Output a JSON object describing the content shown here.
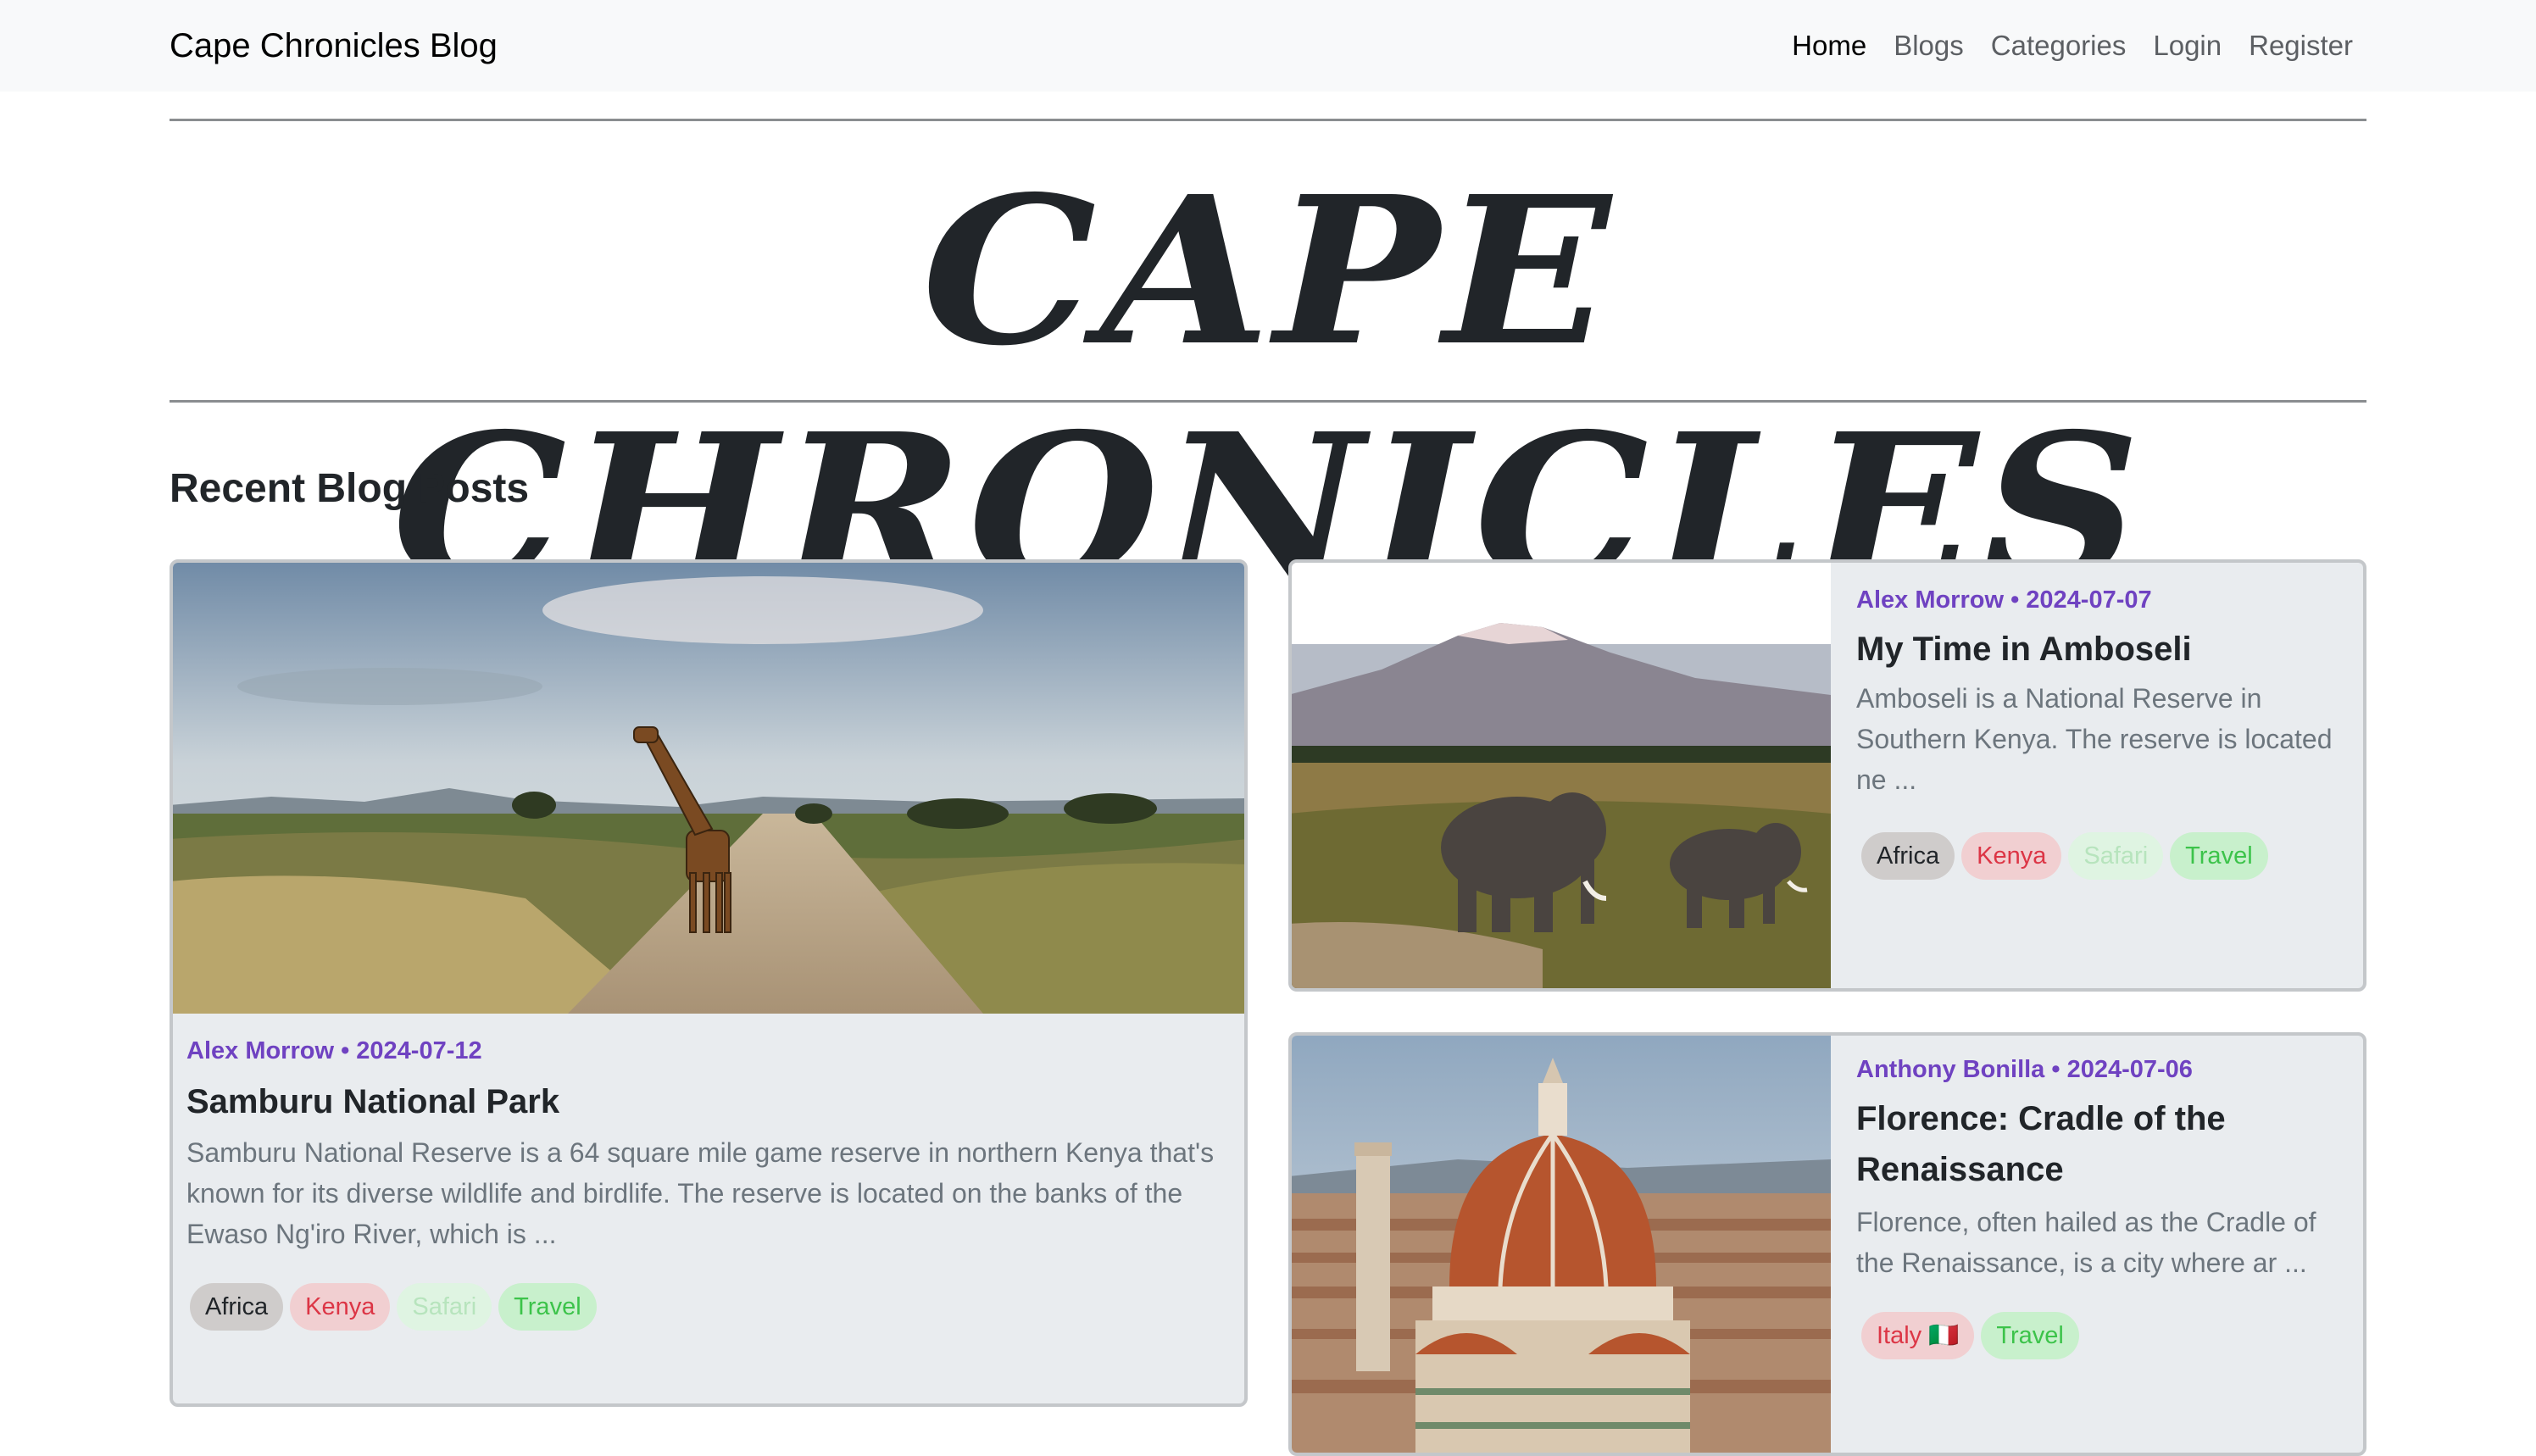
{
  "navbar": {
    "brand": "Cape Chronicles Blog",
    "links": [
      "Home",
      "Blogs",
      "Categories",
      "Login",
      "Register"
    ],
    "active": "Home"
  },
  "masthead": {
    "title": "CAPE CHRONICLES"
  },
  "section": {
    "title": "Recent Blog Posts"
  },
  "posts": [
    {
      "meta": "Alex Morrow • 2024-07-12",
      "title": "Samburu National Park",
      "excerpt": "Samburu National Reserve is a 64 square mile game reserve in northern Kenya that's known for its diverse wildlife and birdlife. The reserve is located on the banks of the Ewaso Ng'iro River, which is ...",
      "tags": [
        "Africa",
        "Kenya",
        "Safari",
        "Travel"
      ],
      "image": "giraffe-on-dirt-road"
    },
    {
      "meta": "Alex Morrow • 2024-07-07",
      "title": "My Time in Amboseli",
      "excerpt": "Amboseli is a National Reserve in Southern Kenya. The reserve is located ne ...",
      "tags": [
        "Africa",
        "Kenya",
        "Safari",
        "Travel"
      ],
      "image": "elephants-kilimanjaro"
    },
    {
      "meta": "Anthony Bonilla • 2024-07-06",
      "title": "Florence: Cradle of the Renaissance",
      "excerpt": "Florence, often hailed as the Cradle of the Renaissance, is a city where ar ...",
      "tags": [
        "Italy 🇮🇹",
        "Travel"
      ],
      "image": "florence-cathedral-dome"
    }
  ],
  "colors": {
    "navbar_bg": "#f8f9fa",
    "card_bg": "#e9ecef",
    "meta": "#6f42c1",
    "excerpt": "#6c757d"
  }
}
